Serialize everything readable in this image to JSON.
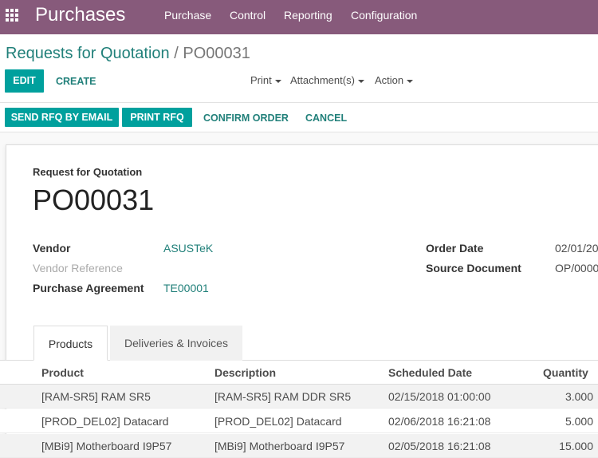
{
  "topbar": {
    "app_name": "Purchases",
    "menu": [
      "Purchase",
      "Control",
      "Reporting",
      "Configuration"
    ]
  },
  "breadcrumb": {
    "parent": "Requests for Quotation",
    "separator": "/",
    "current": "PO00031"
  },
  "actions": {
    "edit": "EDIT",
    "create": "CREATE",
    "print": "Print",
    "attachments": "Attachment(s)",
    "action": "Action"
  },
  "status_buttons": {
    "send_rfq": "SEND RFQ BY EMAIL",
    "print_rfq": "PRINT RFQ",
    "confirm": "CONFIRM ORDER",
    "cancel": "CANCEL"
  },
  "document": {
    "type_label": "Request for Quotation",
    "number": "PO00031"
  },
  "fields": {
    "vendor_label": "Vendor",
    "vendor_value": "ASUSTeK",
    "vendor_ref_label": "Vendor Reference",
    "agreement_label": "Purchase Agreement",
    "agreement_value": "TE00001",
    "order_date_label": "Order Date",
    "order_date_value": "02/01/20",
    "source_doc_label": "Source Document",
    "source_doc_value": "OP/0000"
  },
  "tabs": [
    "Products",
    "Deliveries & Invoices"
  ],
  "table": {
    "headers": [
      "Product",
      "Description",
      "Scheduled Date",
      "Quantity"
    ],
    "rows": [
      [
        "[RAM-SR5] RAM SR5",
        "[RAM-SR5] RAM DDR SR5",
        "02/15/2018 01:00:00",
        "3.000"
      ],
      [
        "[PROD_DEL02] Datacard",
        "[PROD_DEL02] Datacard",
        "02/06/2018 16:21:08",
        "5.000"
      ],
      [
        "[MBi9] Motherboard I9P57",
        "[MBi9] Motherboard I9P57",
        "02/05/2018 16:21:08",
        "15.000"
      ]
    ]
  },
  "colors": {
    "brand": "#875a7b",
    "primary": "#00a09d",
    "link": "#21807a"
  }
}
